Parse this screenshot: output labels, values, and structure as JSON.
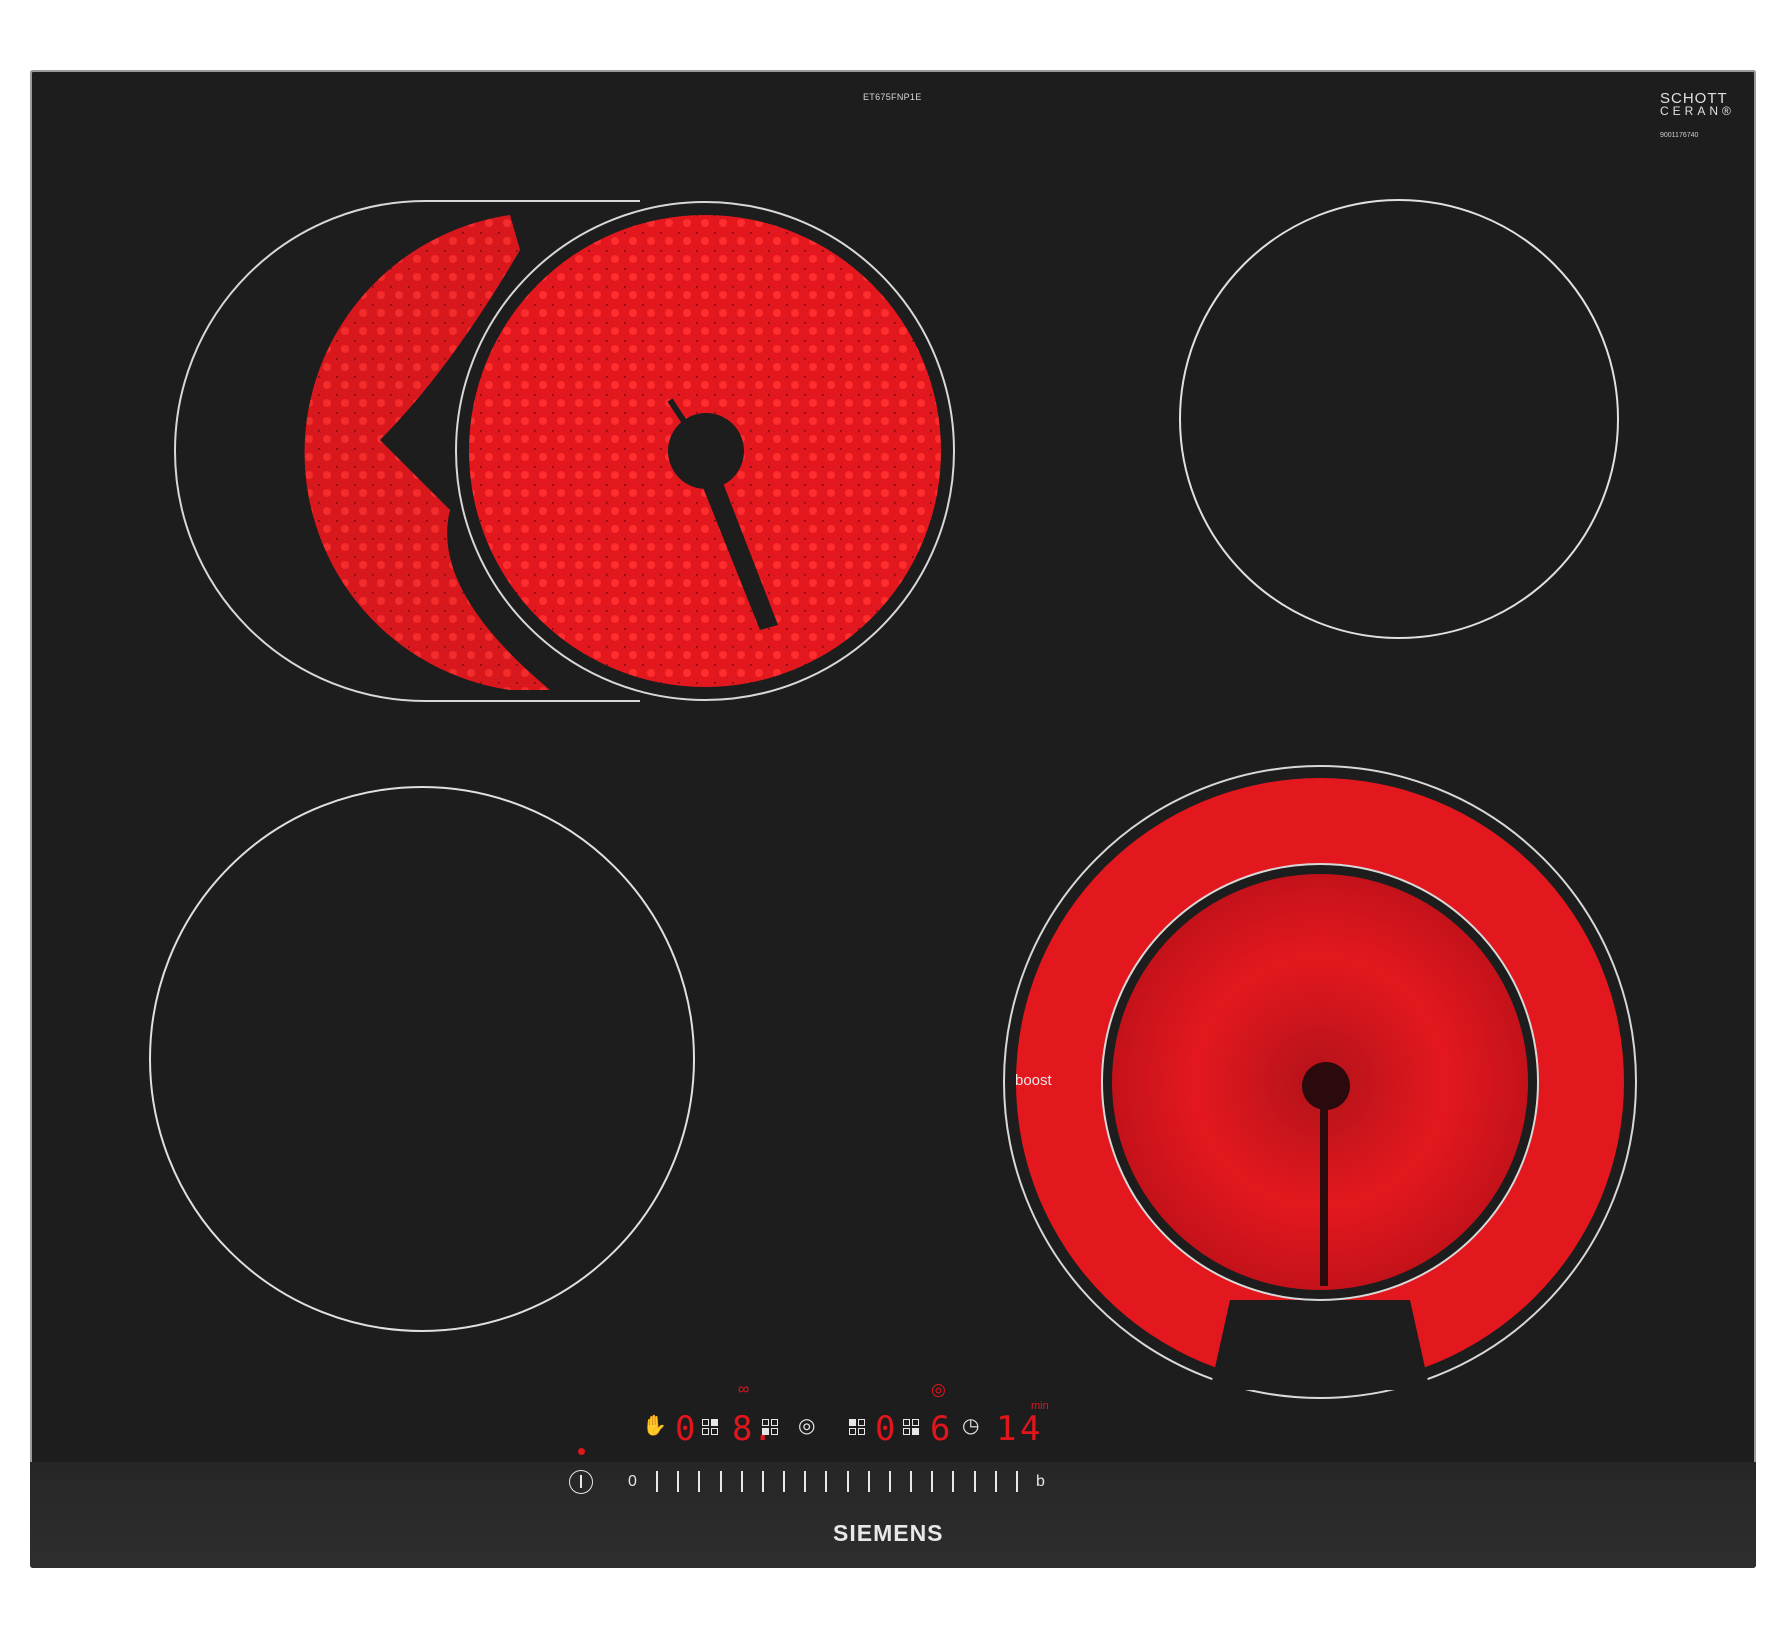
{
  "product": {
    "model_code": "ET675FNP1E",
    "glass_brand_line1": "SCHOTT",
    "glass_brand_line2": "CERAN®",
    "serial": "9001176740",
    "brand": "SIEMENS"
  },
  "zones": [
    {
      "name": "front-left-zone",
      "state": "off"
    },
    {
      "name": "rear-left-oval-zone",
      "state": "on"
    },
    {
      "name": "rear-right-zone",
      "state": "off"
    },
    {
      "name": "front-right-dual-zone",
      "state": "on",
      "label": "boost"
    }
  ],
  "controls": {
    "displays": [
      "0",
      "8.",
      "0",
      "6",
      "1",
      "4"
    ],
    "timer_unit": "min",
    "slider_start": "0",
    "slider_end": "b",
    "slider_steps": 18
  },
  "colors": {
    "glass": "#1d1d1d",
    "heat": "#e0161c",
    "outline": "#e6e6e6"
  }
}
